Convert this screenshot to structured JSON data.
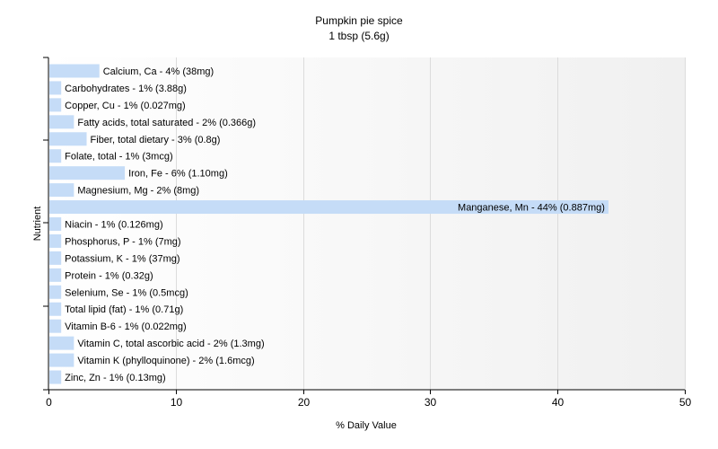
{
  "chart_data": {
    "type": "bar",
    "orientation": "horizontal",
    "title": "Pumpkin pie spice",
    "subtitle": "1 tbsp (5.6g)",
    "xlabel": "% Daily Value",
    "ylabel": "Nutrient",
    "xlim": [
      0,
      50
    ],
    "xticks": [
      0,
      10,
      20,
      30,
      40,
      50
    ],
    "grid": true,
    "colors": {
      "bar": "#c5dcf7",
      "grid": "#dcdcdc",
      "axis": "#000000"
    },
    "categories": [
      "Calcium, Ca",
      "Carbohydrates",
      "Copper, Cu",
      "Fatty acids, total saturated",
      "Fiber, total dietary",
      "Folate, total",
      "Iron, Fe",
      "Magnesium, Mg",
      "Manganese, Mn",
      "Niacin",
      "Phosphorus, P",
      "Potassium, K",
      "Protein",
      "Selenium, Se",
      "Total lipid (fat)",
      "Vitamin B-6",
      "Vitamin C, total ascorbic acid",
      "Vitamin K (phylloquinone)",
      "Zinc, Zn"
    ],
    "values": [
      4,
      1,
      1,
      2,
      3,
      1,
      6,
      2,
      44,
      1,
      1,
      1,
      1,
      1,
      1,
      1,
      2,
      2,
      1
    ],
    "labels": [
      "Calcium, Ca - 4% (38mg)",
      "Carbohydrates - 1% (3.88g)",
      "Copper, Cu - 1% (0.027mg)",
      "Fatty acids, total saturated - 2% (0.366g)",
      "Fiber, total dietary - 3% (0.8g)",
      "Folate, total - 1% (3mcg)",
      "Iron, Fe - 6% (1.10mg)",
      "Magnesium, Mg - 2% (8mg)",
      "Manganese, Mn - 44% (0.887mg)",
      "Niacin - 1% (0.126mg)",
      "Phosphorus, P - 1% (7mg)",
      "Potassium, K - 1% (37mg)",
      "Protein - 1% (0.32g)",
      "Selenium, Se - 1% (0.5mcg)",
      "Total lipid (fat) - 1% (0.71g)",
      "Vitamin B-6 - 1% (0.022mg)",
      "Vitamin C, total ascorbic acid - 2% (1.3mg)",
      "Vitamin K (phylloquinone) - 2% (1.6mcg)",
      "Zinc, Zn - 1% (0.13mg)"
    ]
  }
}
